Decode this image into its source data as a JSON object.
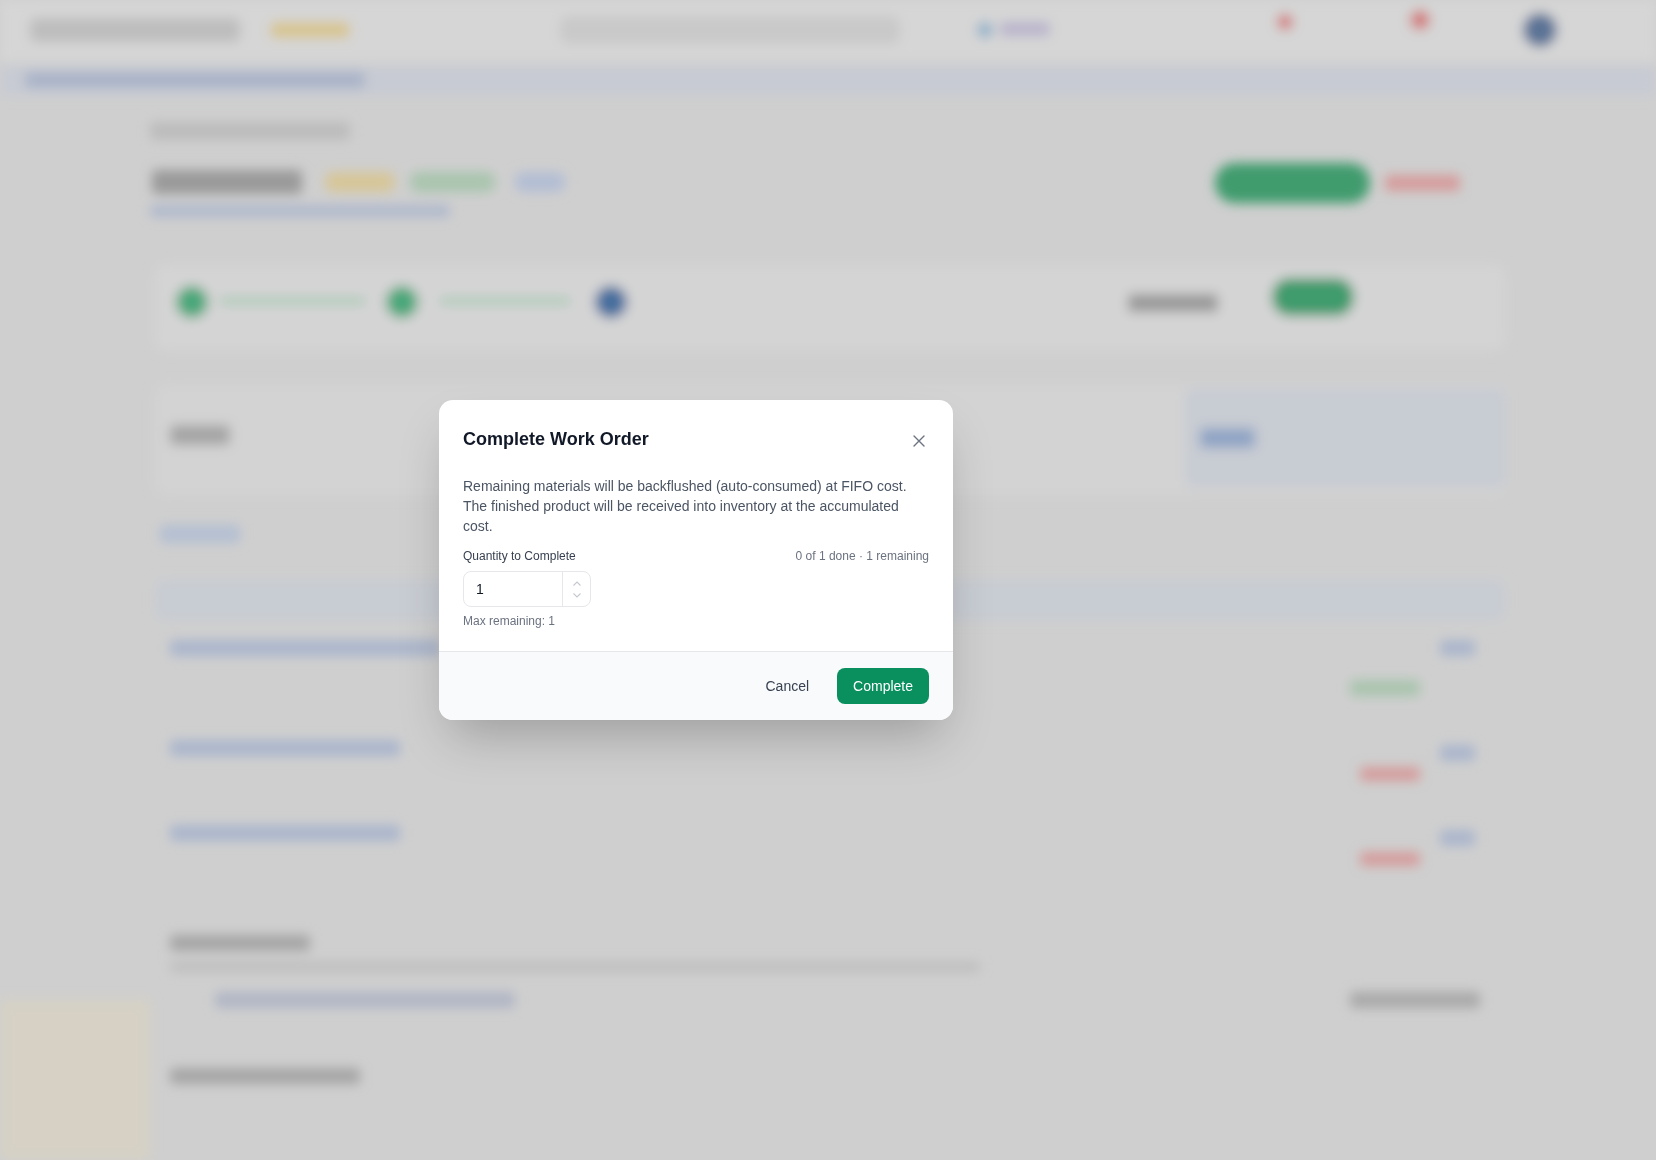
{
  "dialog": {
    "title": "Complete Work Order",
    "description": "Remaining materials will be backflushed (auto-consumed) at FIFO cost. The finished product will be received into inventory at the accumulated cost.",
    "quantity_field": {
      "label": "Quantity to Complete",
      "progress_note": "0 of 1 done · 1 remaining",
      "value": "1",
      "hint": "Max remaining: 1"
    },
    "buttons": [
      {
        "label": "Cancel",
        "kind": "secondary"
      },
      {
        "label": "Complete",
        "kind": "primary"
      }
    ]
  }
}
